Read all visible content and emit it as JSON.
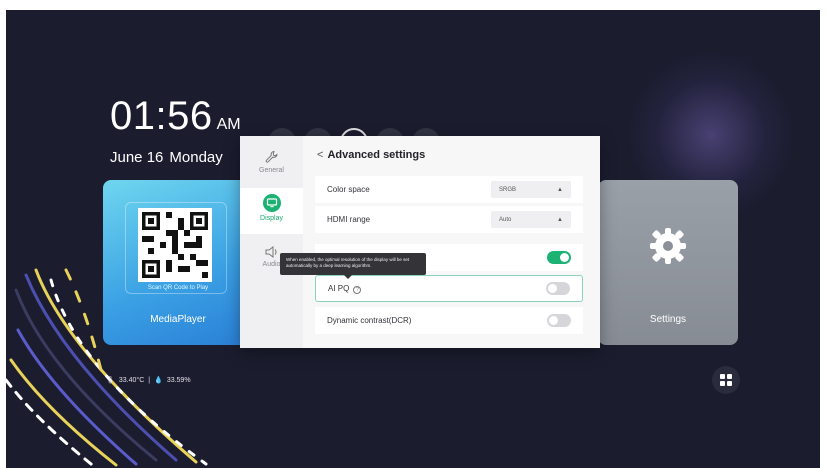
{
  "clock": {
    "time": "01:56",
    "ampm": "AM"
  },
  "date": {
    "day": "June 16",
    "weekday": "Monday"
  },
  "tiles": {
    "media": {
      "scan_label": "Scan QR Code to Play",
      "label": "MediaPlayer"
    },
    "settings": {
      "label": "Settings"
    }
  },
  "status": {
    "temperature": "33.40°C",
    "humidity": "33.59%"
  },
  "sidenav": {
    "general": "General",
    "display": "Display",
    "audio": "Audio"
  },
  "advanced": {
    "title": "Advanced settings",
    "color_space": {
      "label": "Color space",
      "value": "SRGB"
    },
    "hdmi_range": {
      "label": "HDMI range",
      "value": "Auto"
    },
    "ai_pq": {
      "label": "AI PQ",
      "enabled": false
    },
    "dcr": {
      "label": "Dynamic contrast(DCR)",
      "enabled": false
    },
    "top_toggle": {
      "enabled": true
    },
    "tooltip": "When enabled, the optimal resolution of the display will be set automatically by a deep learning algorithm."
  },
  "colors": {
    "accent": "#1bb273",
    "background": "#1b1c2e"
  }
}
